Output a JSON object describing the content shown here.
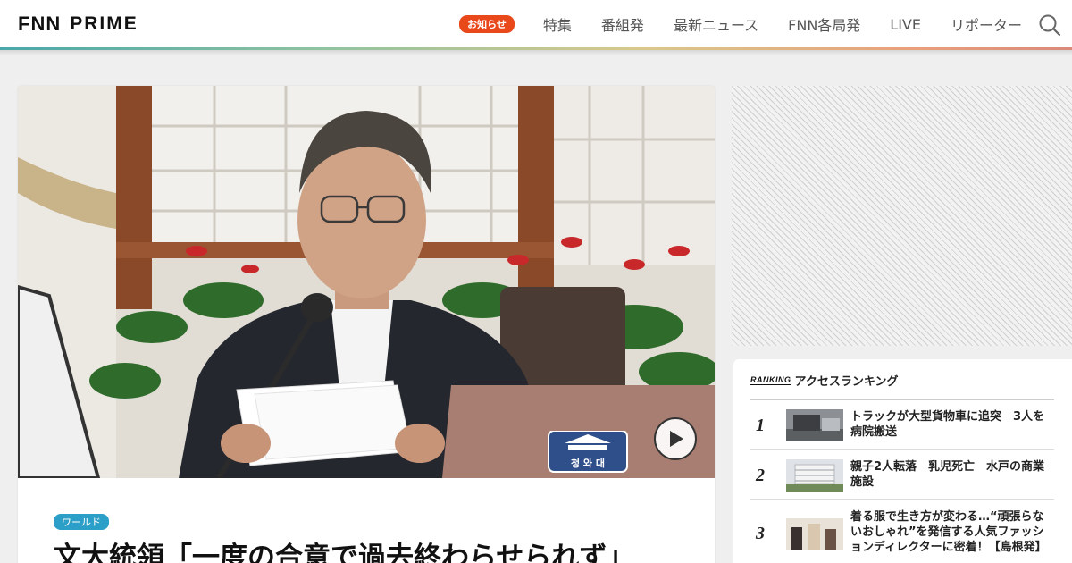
{
  "header": {
    "logo_fnn": "FNN",
    "logo_prime": "PRIME",
    "notice_badge": "お知らせ",
    "nav": [
      "特集",
      "番組発",
      "最新ニュース",
      "FNN各局発",
      "LIVE",
      "リポーター"
    ],
    "icons": {
      "search": "search-icon"
    }
  },
  "article": {
    "category": "ワールド",
    "headline": "文大統領「一度の合意で過去終わらせられず」",
    "seal_text": "청 와 대",
    "icons": {
      "play": "play-icon"
    }
  },
  "ranking": {
    "logo": "RANKING",
    "title": "アクセスランキング",
    "items": [
      {
        "rank": "1",
        "title": "トラックが大型貨物車に追突　3人を病院搬送"
      },
      {
        "rank": "2",
        "title": "親子2人転落　乳児死亡　水戸の商業施設"
      },
      {
        "rank": "3",
        "title": "着る服で生き方が変わる…“頑張らないおしゃれ”を発信する人気ファッションディレクターに密着！【島根発】"
      }
    ]
  },
  "colors": {
    "notice_badge": "#e8481a",
    "category_badge": "#2c9fc8",
    "background": "#efefef"
  }
}
